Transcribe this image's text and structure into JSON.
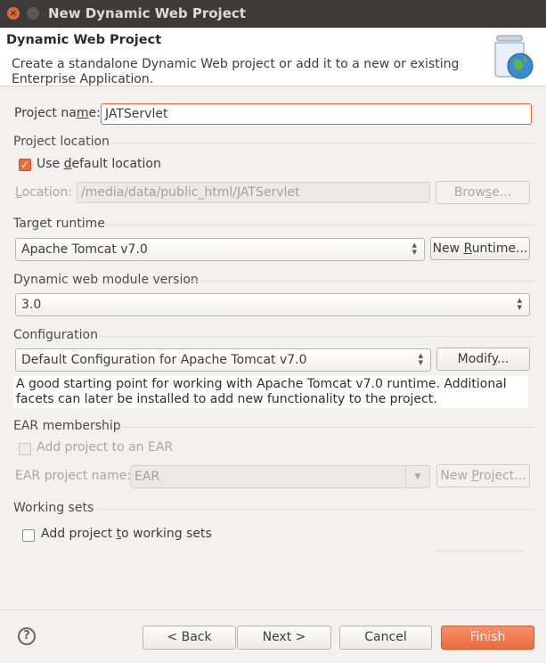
{
  "window": {
    "title": "New Dynamic Web Project"
  },
  "header": {
    "title": "Dynamic Web Project",
    "description": "Create a standalone Dynamic Web project or add it to a new or existing Enterprise Application."
  },
  "project_name": {
    "label_a": "Project na",
    "label_u": "m",
    "label_b": "e:",
    "value": "JATServlet"
  },
  "project_location": {
    "group_title": "Project location",
    "use_default_a": "Use ",
    "use_default_u": "d",
    "use_default_b": "efault location",
    "use_default_checked": true,
    "location_label_u": "L",
    "location_label_b": "ocation:",
    "location_value": "/media/data/public_html/JATServlet",
    "browse_a": "Brow",
    "browse_u": "s",
    "browse_b": "e..."
  },
  "target_runtime": {
    "group_title": "Target runtime",
    "selected": "Apache Tomcat v7.0",
    "new_runtime_a": "New ",
    "new_runtime_u": "R",
    "new_runtime_b": "untime..."
  },
  "module_version": {
    "group_title": "Dynamic web module version",
    "selected": "3.0"
  },
  "configuration": {
    "group_title": "Configuration",
    "selected": "Default Configuration for Apache Tomcat v7.0",
    "modify_a": "Modif",
    "modify_u": "y",
    "modify_b": "...",
    "description": "A good starting point for working with Apache Tomcat v7.0 runtime. Additional facets can later be installed to add new functionality to the project."
  },
  "ear": {
    "group_title": "EAR membership",
    "add_to_ear": "Add project to an EAR",
    "add_to_ear_checked": false,
    "ear_name_label": "EAR project name:",
    "ear_name_value": "EAR",
    "new_project_a": "New ",
    "new_project_u": "P",
    "new_project_b": "roject..."
  },
  "working_sets": {
    "group_title": "Working sets",
    "add_label_a": "Add project ",
    "add_label_u": "t",
    "add_label_b": "o working sets",
    "checked": false
  },
  "footer": {
    "help_symbol": "?",
    "back": "< Back",
    "next": "Next >",
    "cancel": "Cancel",
    "finish": "Finish"
  },
  "colors": {
    "accent": "#ec6a3e",
    "titlebar": "#3c3b37",
    "background": "#f2f1f0"
  },
  "icons": [
    "close-icon",
    "minimize-icon",
    "wizard-banner-icon",
    "help-icon",
    "dropdown-arrows-icon"
  ]
}
